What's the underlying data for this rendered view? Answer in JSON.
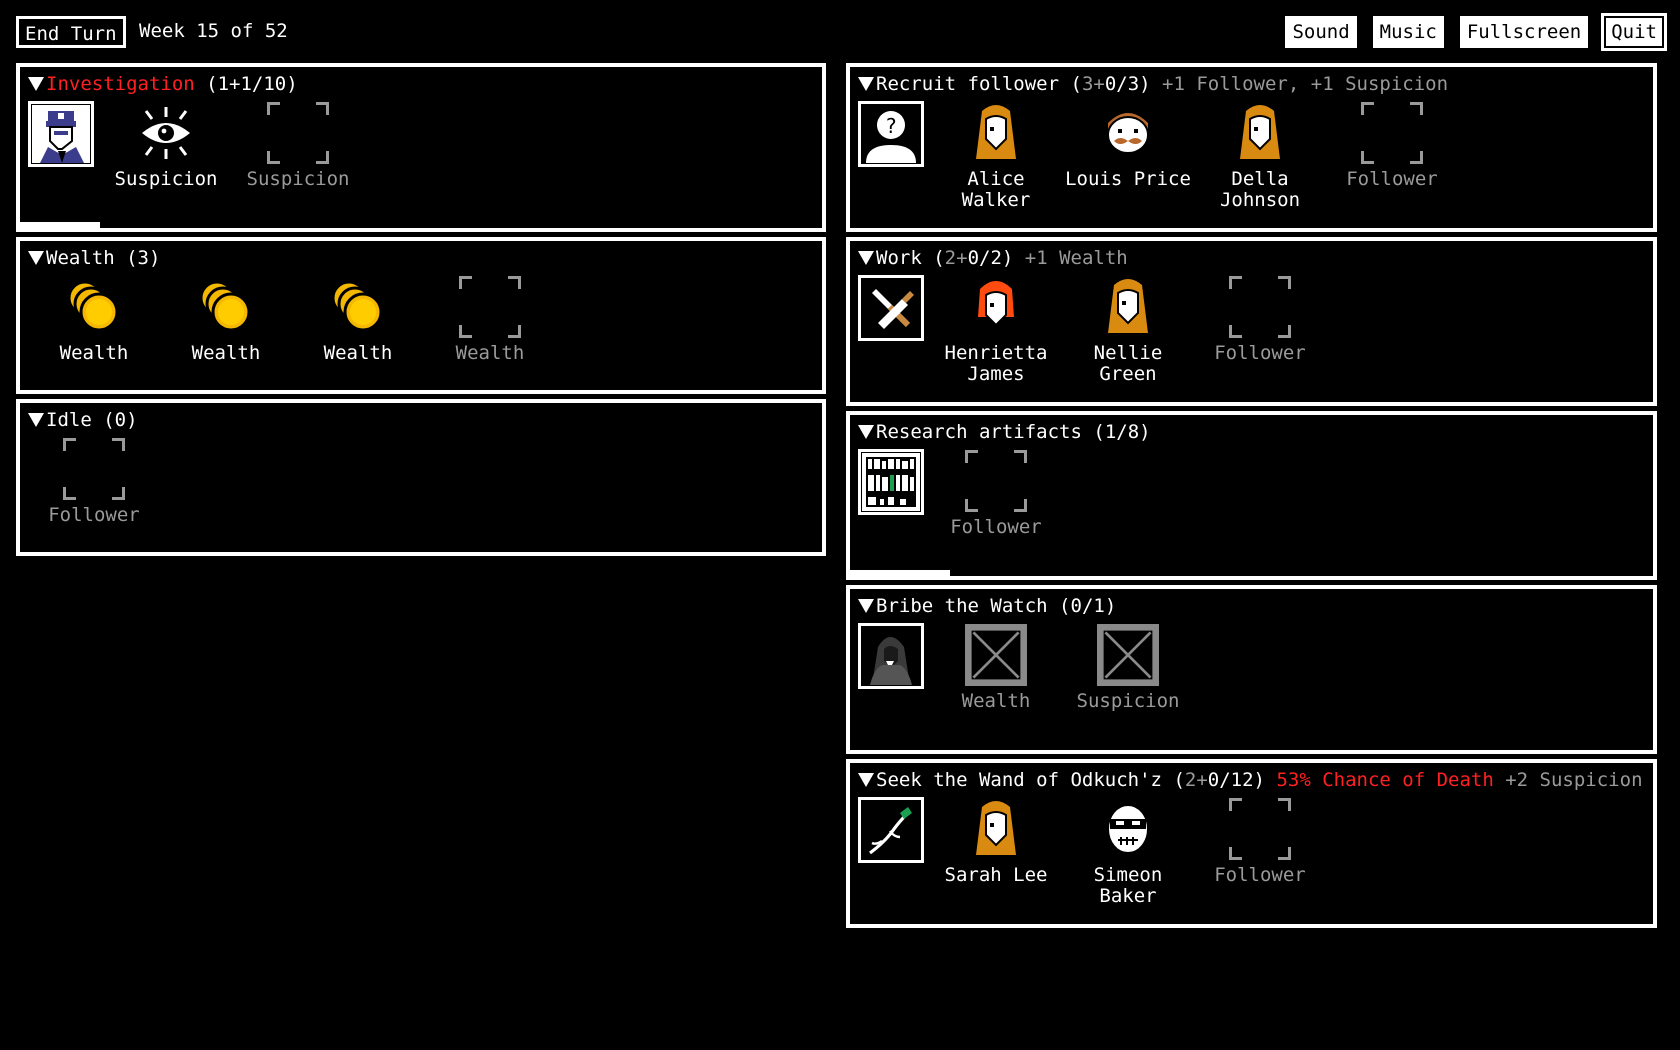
{
  "topbar": {
    "end_turn": "End Turn",
    "week": "Week 15 of 52",
    "buttons": [
      "Sound",
      "Music",
      "Fullscreen",
      "Quit"
    ]
  },
  "colors": {
    "red": "#ff2020",
    "gold": "#f5b800",
    "hair_orange": "#d98a10",
    "hair_red": "#ff4a10"
  },
  "left": [
    {
      "title": "Investigation",
      "count": "(1+1/10)",
      "progress": 0.1,
      "icon": "policeman-icon",
      "slots": [
        {
          "label": "Suspicion",
          "icon": "eye-icon",
          "filled": true
        },
        {
          "label": "Suspicion",
          "icon": "empty-slot",
          "filled": false
        }
      ]
    },
    {
      "title": "Wealth",
      "count": "(3)",
      "slots": [
        {
          "label": "Wealth",
          "icon": "coins-icon",
          "filled": true
        },
        {
          "label": "Wealth",
          "icon": "coins-icon",
          "filled": true
        },
        {
          "label": "Wealth",
          "icon": "coins-icon",
          "filled": true
        },
        {
          "label": "Wealth",
          "icon": "empty-slot",
          "filled": false
        }
      ]
    },
    {
      "title": "Idle",
      "count": "(0)",
      "slots": [
        {
          "label": "Follower",
          "icon": "empty-slot",
          "filled": false
        }
      ]
    }
  ],
  "right": [
    {
      "title": "Recruit follower",
      "count_open": "(",
      "count_gray": "3+",
      "count_rest": "0/3)",
      "effect": "+1 Follower, +1 Suspicion",
      "icon": "unknown-person-icon",
      "slots": [
        {
          "label": "Alice Walker",
          "icon": "woman-orange-icon",
          "filled": true
        },
        {
          "label": "Louis Price",
          "icon": "man-mustache-icon",
          "filled": true
        },
        {
          "label": "Della Johnson",
          "icon": "woman-orange-icon",
          "filled": true
        },
        {
          "label": "Follower",
          "icon": "empty-slot",
          "filled": false
        }
      ]
    },
    {
      "title": "Work",
      "count_open": "(",
      "count_gray": "2+",
      "count_rest": "0/2)",
      "effect": "+1 Wealth",
      "icon": "hammer-saw-icon",
      "slots": [
        {
          "label": "Henrietta James",
          "icon": "woman-red-icon",
          "filled": true
        },
        {
          "label": "Nellie Green",
          "icon": "woman-orange-icon",
          "filled": true
        },
        {
          "label": "Follower",
          "icon": "empty-slot",
          "filled": false
        }
      ]
    },
    {
      "title": "Research artifacts",
      "count_open": "(",
      "count_gray": "",
      "count_rest": "1/8)",
      "effect": "",
      "progress": 0.125,
      "icon": "bookshelf-icon",
      "slots": [
        {
          "label": "Follower",
          "icon": "empty-slot",
          "filled": false
        }
      ]
    },
    {
      "title": "Bribe the Watch",
      "count_open": "(",
      "count_gray": "",
      "count_rest": "0/1)",
      "effect": "",
      "icon": "hooded-figure-icon",
      "slots": [
        {
          "label": "Wealth",
          "icon": "x-slot",
          "filled": false
        },
        {
          "label": "Suspicion",
          "icon": "x-slot",
          "filled": false
        }
      ]
    },
    {
      "title": "Seek the Wand of Odkuch'z",
      "count_open": "(",
      "count_gray": "2+",
      "count_rest": "0/12)",
      "danger": "53% Chance of Death",
      "effect": "+2 Suspicion",
      "icon": "wand-icon",
      "slots": [
        {
          "label": "Sarah Lee",
          "icon": "woman-orange-icon",
          "filled": true
        },
        {
          "label": "Simeon Baker",
          "icon": "masked-man-icon",
          "filled": true
        },
        {
          "label": "Follower",
          "icon": "empty-slot",
          "filled": false
        }
      ]
    }
  ]
}
